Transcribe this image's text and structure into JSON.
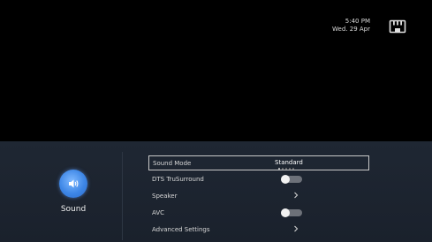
{
  "status": {
    "time": "5:40 PM",
    "date": "Wed. 29 Apr"
  },
  "category": {
    "label": "Sound",
    "icon": "speaker-icon",
    "accent": "#3d86e6"
  },
  "menu": {
    "items": [
      {
        "label": "Sound Mode",
        "type": "select",
        "value": "Standard",
        "selected": true,
        "option_count": 5,
        "option_index": 0
      },
      {
        "label": "DTS TruSurround",
        "type": "toggle",
        "on": false
      },
      {
        "label": "Speaker",
        "type": "submenu"
      },
      {
        "label": "AVC",
        "type": "toggle",
        "on": false
      },
      {
        "label": "Advanced Settings",
        "type": "submenu"
      }
    ]
  }
}
